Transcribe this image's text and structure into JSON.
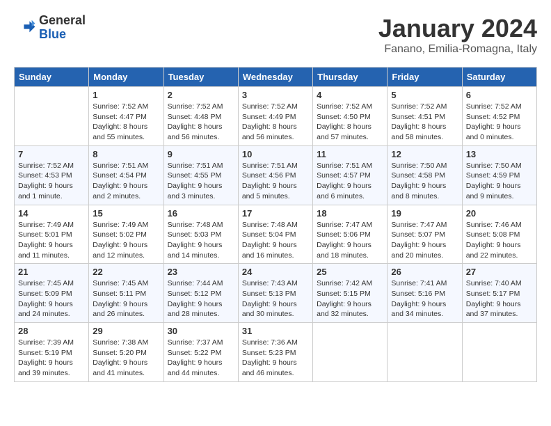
{
  "header": {
    "logo_general": "General",
    "logo_blue": "Blue",
    "month_title": "January 2024",
    "location": "Fanano, Emilia-Romagna, Italy"
  },
  "weekdays": [
    "Sunday",
    "Monday",
    "Tuesday",
    "Wednesday",
    "Thursday",
    "Friday",
    "Saturday"
  ],
  "weeks": [
    [
      {
        "day": "",
        "info": ""
      },
      {
        "day": "1",
        "info": "Sunrise: 7:52 AM\nSunset: 4:47 PM\nDaylight: 8 hours\nand 55 minutes."
      },
      {
        "day": "2",
        "info": "Sunrise: 7:52 AM\nSunset: 4:48 PM\nDaylight: 8 hours\nand 56 minutes."
      },
      {
        "day": "3",
        "info": "Sunrise: 7:52 AM\nSunset: 4:49 PM\nDaylight: 8 hours\nand 56 minutes."
      },
      {
        "day": "4",
        "info": "Sunrise: 7:52 AM\nSunset: 4:50 PM\nDaylight: 8 hours\nand 57 minutes."
      },
      {
        "day": "5",
        "info": "Sunrise: 7:52 AM\nSunset: 4:51 PM\nDaylight: 8 hours\nand 58 minutes."
      },
      {
        "day": "6",
        "info": "Sunrise: 7:52 AM\nSunset: 4:52 PM\nDaylight: 9 hours\nand 0 minutes."
      }
    ],
    [
      {
        "day": "7",
        "info": "Sunrise: 7:52 AM\nSunset: 4:53 PM\nDaylight: 9 hours\nand 1 minute."
      },
      {
        "day": "8",
        "info": "Sunrise: 7:51 AM\nSunset: 4:54 PM\nDaylight: 9 hours\nand 2 minutes."
      },
      {
        "day": "9",
        "info": "Sunrise: 7:51 AM\nSunset: 4:55 PM\nDaylight: 9 hours\nand 3 minutes."
      },
      {
        "day": "10",
        "info": "Sunrise: 7:51 AM\nSunset: 4:56 PM\nDaylight: 9 hours\nand 5 minutes."
      },
      {
        "day": "11",
        "info": "Sunrise: 7:51 AM\nSunset: 4:57 PM\nDaylight: 9 hours\nand 6 minutes."
      },
      {
        "day": "12",
        "info": "Sunrise: 7:50 AM\nSunset: 4:58 PM\nDaylight: 9 hours\nand 8 minutes."
      },
      {
        "day": "13",
        "info": "Sunrise: 7:50 AM\nSunset: 4:59 PM\nDaylight: 9 hours\nand 9 minutes."
      }
    ],
    [
      {
        "day": "14",
        "info": "Sunrise: 7:49 AM\nSunset: 5:01 PM\nDaylight: 9 hours\nand 11 minutes."
      },
      {
        "day": "15",
        "info": "Sunrise: 7:49 AM\nSunset: 5:02 PM\nDaylight: 9 hours\nand 12 minutes."
      },
      {
        "day": "16",
        "info": "Sunrise: 7:48 AM\nSunset: 5:03 PM\nDaylight: 9 hours\nand 14 minutes."
      },
      {
        "day": "17",
        "info": "Sunrise: 7:48 AM\nSunset: 5:04 PM\nDaylight: 9 hours\nand 16 minutes."
      },
      {
        "day": "18",
        "info": "Sunrise: 7:47 AM\nSunset: 5:06 PM\nDaylight: 9 hours\nand 18 minutes."
      },
      {
        "day": "19",
        "info": "Sunrise: 7:47 AM\nSunset: 5:07 PM\nDaylight: 9 hours\nand 20 minutes."
      },
      {
        "day": "20",
        "info": "Sunrise: 7:46 AM\nSunset: 5:08 PM\nDaylight: 9 hours\nand 22 minutes."
      }
    ],
    [
      {
        "day": "21",
        "info": "Sunrise: 7:45 AM\nSunset: 5:09 PM\nDaylight: 9 hours\nand 24 minutes."
      },
      {
        "day": "22",
        "info": "Sunrise: 7:45 AM\nSunset: 5:11 PM\nDaylight: 9 hours\nand 26 minutes."
      },
      {
        "day": "23",
        "info": "Sunrise: 7:44 AM\nSunset: 5:12 PM\nDaylight: 9 hours\nand 28 minutes."
      },
      {
        "day": "24",
        "info": "Sunrise: 7:43 AM\nSunset: 5:13 PM\nDaylight: 9 hours\nand 30 minutes."
      },
      {
        "day": "25",
        "info": "Sunrise: 7:42 AM\nSunset: 5:15 PM\nDaylight: 9 hours\nand 32 minutes."
      },
      {
        "day": "26",
        "info": "Sunrise: 7:41 AM\nSunset: 5:16 PM\nDaylight: 9 hours\nand 34 minutes."
      },
      {
        "day": "27",
        "info": "Sunrise: 7:40 AM\nSunset: 5:17 PM\nDaylight: 9 hours\nand 37 minutes."
      }
    ],
    [
      {
        "day": "28",
        "info": "Sunrise: 7:39 AM\nSunset: 5:19 PM\nDaylight: 9 hours\nand 39 minutes."
      },
      {
        "day": "29",
        "info": "Sunrise: 7:38 AM\nSunset: 5:20 PM\nDaylight: 9 hours\nand 41 minutes."
      },
      {
        "day": "30",
        "info": "Sunrise: 7:37 AM\nSunset: 5:22 PM\nDaylight: 9 hours\nand 44 minutes."
      },
      {
        "day": "31",
        "info": "Sunrise: 7:36 AM\nSunset: 5:23 PM\nDaylight: 9 hours\nand 46 minutes."
      },
      {
        "day": "",
        "info": ""
      },
      {
        "day": "",
        "info": ""
      },
      {
        "day": "",
        "info": ""
      }
    ]
  ]
}
